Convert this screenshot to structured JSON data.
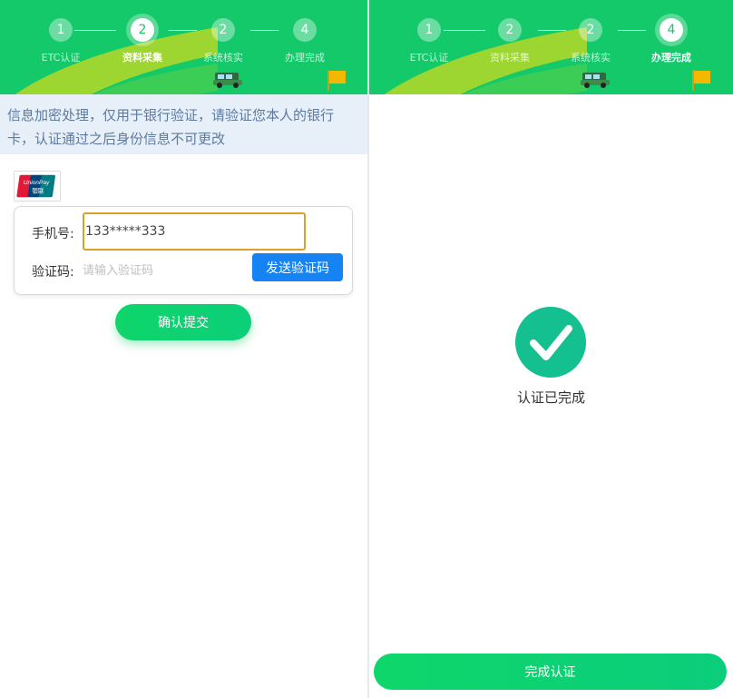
{
  "colors": {
    "header_green": "#13c96a",
    "swoosh_yellow": "#a4d72e",
    "notice_bg": "#e7eff9",
    "notice_text": "#5e7aa0",
    "send_button_blue": "#1683f5",
    "input_focus_border": "#d9a126",
    "success_green": "#14c08f",
    "flag_yellow": "#f5b800"
  },
  "left": {
    "steps": [
      {
        "number": "1",
        "label": "ETC认证",
        "state": "done"
      },
      {
        "number": "2",
        "label": "资料采集",
        "state": "active"
      },
      {
        "number": "2",
        "label": "系统核实",
        "state": "pending"
      },
      {
        "number": "4",
        "label": "办理完成",
        "state": "pending"
      }
    ],
    "notice": "信息加密处理，仅用于银行验证，请验证您本人的银行卡，认证通过之后身份信息不可更改",
    "card_logo_text": {
      "top": "UnionPay",
      "bottom": "银联"
    },
    "form": {
      "phone_label": "手机号:",
      "phone_value": "133*****333",
      "code_label": "验证码:",
      "code_placeholder": "请输入验证码",
      "send_button": "发送验证码"
    },
    "submit_button": "确认提交"
  },
  "right": {
    "steps": [
      {
        "number": "1",
        "label": "ETC认证",
        "state": "done"
      },
      {
        "number": "2",
        "label": "资料采集",
        "state": "done"
      },
      {
        "number": "2",
        "label": "系统核实",
        "state": "done"
      },
      {
        "number": "4",
        "label": "办理完成",
        "state": "active"
      }
    ],
    "success_text": "认证已完成",
    "finish_button": "完成认证"
  },
  "icons": {
    "car": "car-icon",
    "flag": "flag-icon",
    "check": "check-circle-icon",
    "unionpay": "unionpay-logo"
  }
}
